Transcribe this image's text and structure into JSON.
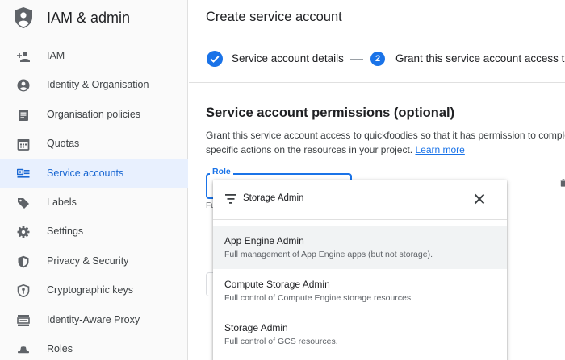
{
  "sidebar": {
    "title": "IAM & admin",
    "logo_icon": "shield-icon",
    "items": [
      {
        "label": "IAM",
        "icon": "add-person-icon",
        "active": false
      },
      {
        "label": "Identity & Organisation",
        "icon": "account-circle-icon",
        "active": false
      },
      {
        "label": "Organisation policies",
        "icon": "document-icon",
        "active": false
      },
      {
        "label": "Quotas",
        "icon": "calendar-icon",
        "active": false
      },
      {
        "label": "Service accounts",
        "icon": "service-account-icon",
        "active": true
      },
      {
        "label": "Labels",
        "icon": "label-icon",
        "active": false
      },
      {
        "label": "Settings",
        "icon": "gear-icon",
        "active": false
      },
      {
        "label": "Privacy & Security",
        "icon": "shield-small-icon",
        "active": false
      },
      {
        "label": "Cryptographic keys",
        "icon": "key-shield-icon",
        "active": false
      },
      {
        "label": "Identity-Aware Proxy",
        "icon": "proxy-icon",
        "active": false
      },
      {
        "label": "Roles",
        "icon": "hat-icon",
        "active": false
      }
    ]
  },
  "header": {
    "title": "Create service account"
  },
  "stepper": {
    "step1": {
      "label": "Service account details",
      "state": "complete"
    },
    "step2": {
      "number": "2",
      "label": "Grant this service account access t"
    }
  },
  "permissions": {
    "title": "Service account permissions (optional)",
    "desc_line1": "Grant this service account access to quickfoodies so that it has permission to comple",
    "desc_line2": "specific actions on the resources in your project.",
    "learn_more": "Learn more",
    "role_label": "Role",
    "helper": "Fu"
  },
  "dropdown": {
    "query": "Storage Admin",
    "options": [
      {
        "name": "App Engine Admin",
        "desc": "Full management of App Engine apps (but not storage).",
        "highlighted": true
      },
      {
        "name": "Compute Storage Admin",
        "desc": "Full control of Compute Engine storage resources.",
        "highlighted": false
      },
      {
        "name": "Storage Admin",
        "desc": "Full control of GCS resources.",
        "highlighted": false
      }
    ]
  },
  "colors": {
    "accent": "#1a73e8",
    "active_bg": "#e8f0fe",
    "active_text": "#1967d2",
    "icon_gray": "#5f6368"
  }
}
